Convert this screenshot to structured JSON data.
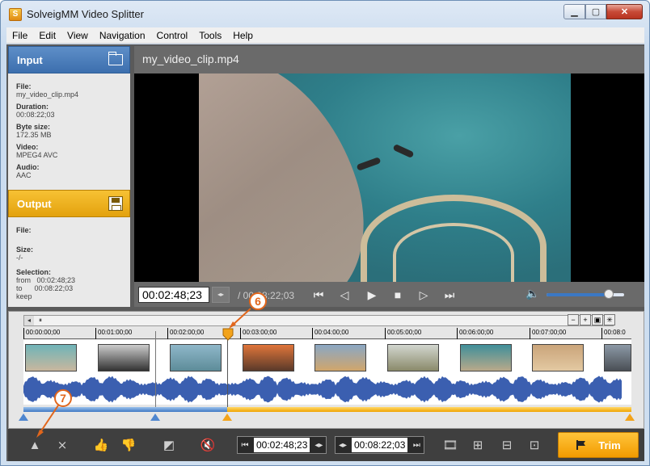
{
  "window": {
    "title": "SolveigMM Video Splitter",
    "app_icon": "S"
  },
  "menu": [
    "File",
    "Edit",
    "View",
    "Navigation",
    "Control",
    "Tools",
    "Help"
  ],
  "input": {
    "title": "Input",
    "file_label": "File:",
    "file": "my_video_clip.mp4",
    "duration_label": "Duration:",
    "duration": "00:08:22;03",
    "byte_size_label": "Byte size:",
    "byte_size": "172.35 MB",
    "video_label": "Video:",
    "video": "MPEG4 AVC",
    "audio_label": "Audio:",
    "audio": "AAC"
  },
  "output": {
    "title": "Output",
    "file_label": "File:",
    "file": "",
    "size_label": "Size:",
    "size": "-/-",
    "selection_label": "Selection:",
    "from_label": "from",
    "from": "00:02:48;23",
    "to_label": "to",
    "to": "00:08:22;03",
    "mode": "keep"
  },
  "player": {
    "clip_name": "my_video_clip.mp4",
    "current_time": "00:02:48;23",
    "total_time": "/ 00:08:22;03",
    "volume": 0.8
  },
  "timeline": {
    "ticks": [
      "00:00:00;00",
      "00:01:00;00",
      "00:02:00;00",
      "00:03:00;00",
      "00:04:00;00",
      "00:05:00;00",
      "00:06:00;00",
      "00:07:00;00",
      "00:08:0"
    ]
  },
  "toolbar": {
    "start_time": "00:02:48;23",
    "end_time": "00:08:22;03",
    "trim_label": "Trim"
  },
  "callouts": [
    "6",
    "7"
  ],
  "colors": {
    "accent_blue": "#3c6fae",
    "accent_orange": "#f29b00",
    "callout": "#e1661c"
  }
}
